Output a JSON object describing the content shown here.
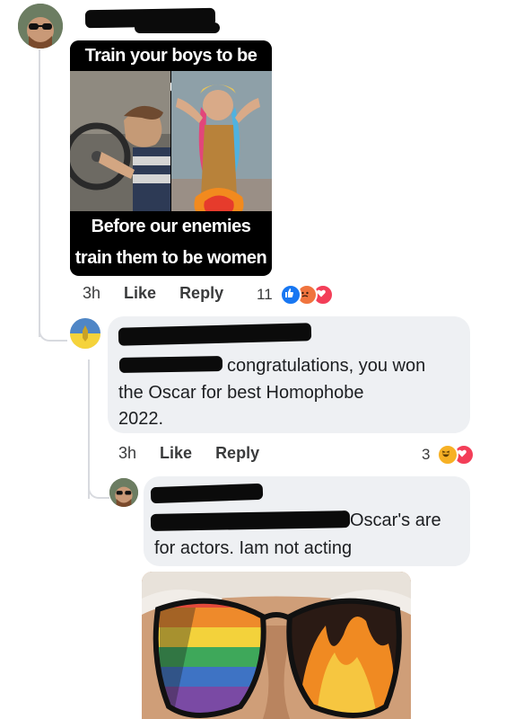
{
  "post": {
    "meme": {
      "top_caption": "Train your boys to be men",
      "bottom_caption_line1": "Before our enemies",
      "bottom_caption_line2": "train them to be women"
    },
    "time": "3h",
    "like_label": "Like",
    "reply_label": "Reply",
    "reaction_count": "11",
    "reactions": [
      "like-icon",
      "angry-icon",
      "love-icon"
    ]
  },
  "reply1": {
    "text_line1": "congratulations, you won",
    "text_line2": "the Oscar for best Homophobe",
    "text_line3": "2022.",
    "time": "3h",
    "like_label": "Like",
    "reply_label": "Reply",
    "reaction_count": "3",
    "reactions": [
      "haha-icon",
      "love-icon"
    ]
  },
  "reply2": {
    "text_line1": "Oscar's are",
    "text_line2": "for actors. Iam not acting"
  },
  "colors": {
    "like_blue": "#1877f2",
    "angry_orange": "#f0743e",
    "love_red": "#f33e58",
    "haha_yellow": "#f7b125",
    "bubble_gray": "#eef0f3"
  }
}
